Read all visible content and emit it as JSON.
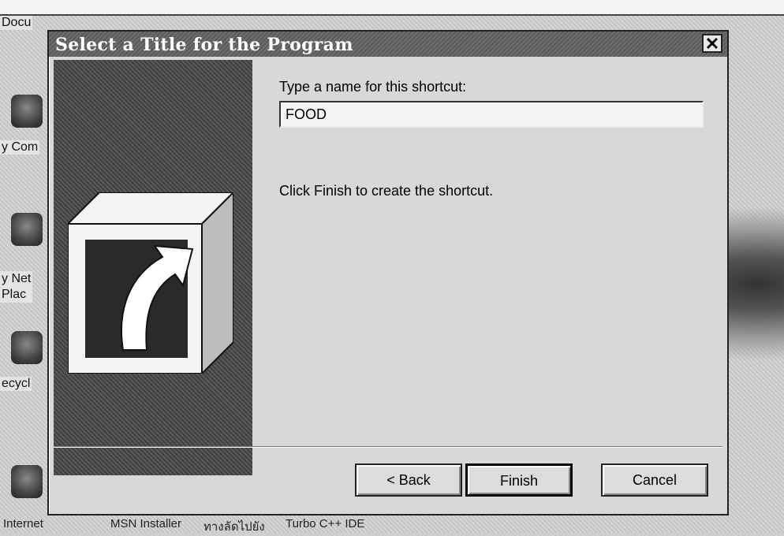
{
  "desktop": {
    "top_label": "Docu",
    "icons": [
      {
        "label": "y Com"
      },
      {
        "label": "y Net\nPlac"
      },
      {
        "label": "ecycl"
      },
      {
        "label": "Internet"
      }
    ],
    "taskbar_items": [
      "Internet",
      "MSN Installer",
      "ทางลัดไปยัง",
      "Turbo C++ IDE"
    ]
  },
  "dialog": {
    "title": "Select a Title for the Program",
    "close_glyph": "✕",
    "prompt_label": "Type a name for this shortcut:",
    "shortcut_name_value": "FOOD",
    "finish_hint": "Click Finish to create the shortcut.",
    "buttons": {
      "back": "< Back",
      "finish": "Finish",
      "cancel": "Cancel"
    },
    "left_panel_icon": "shortcut-arrow-icon"
  }
}
